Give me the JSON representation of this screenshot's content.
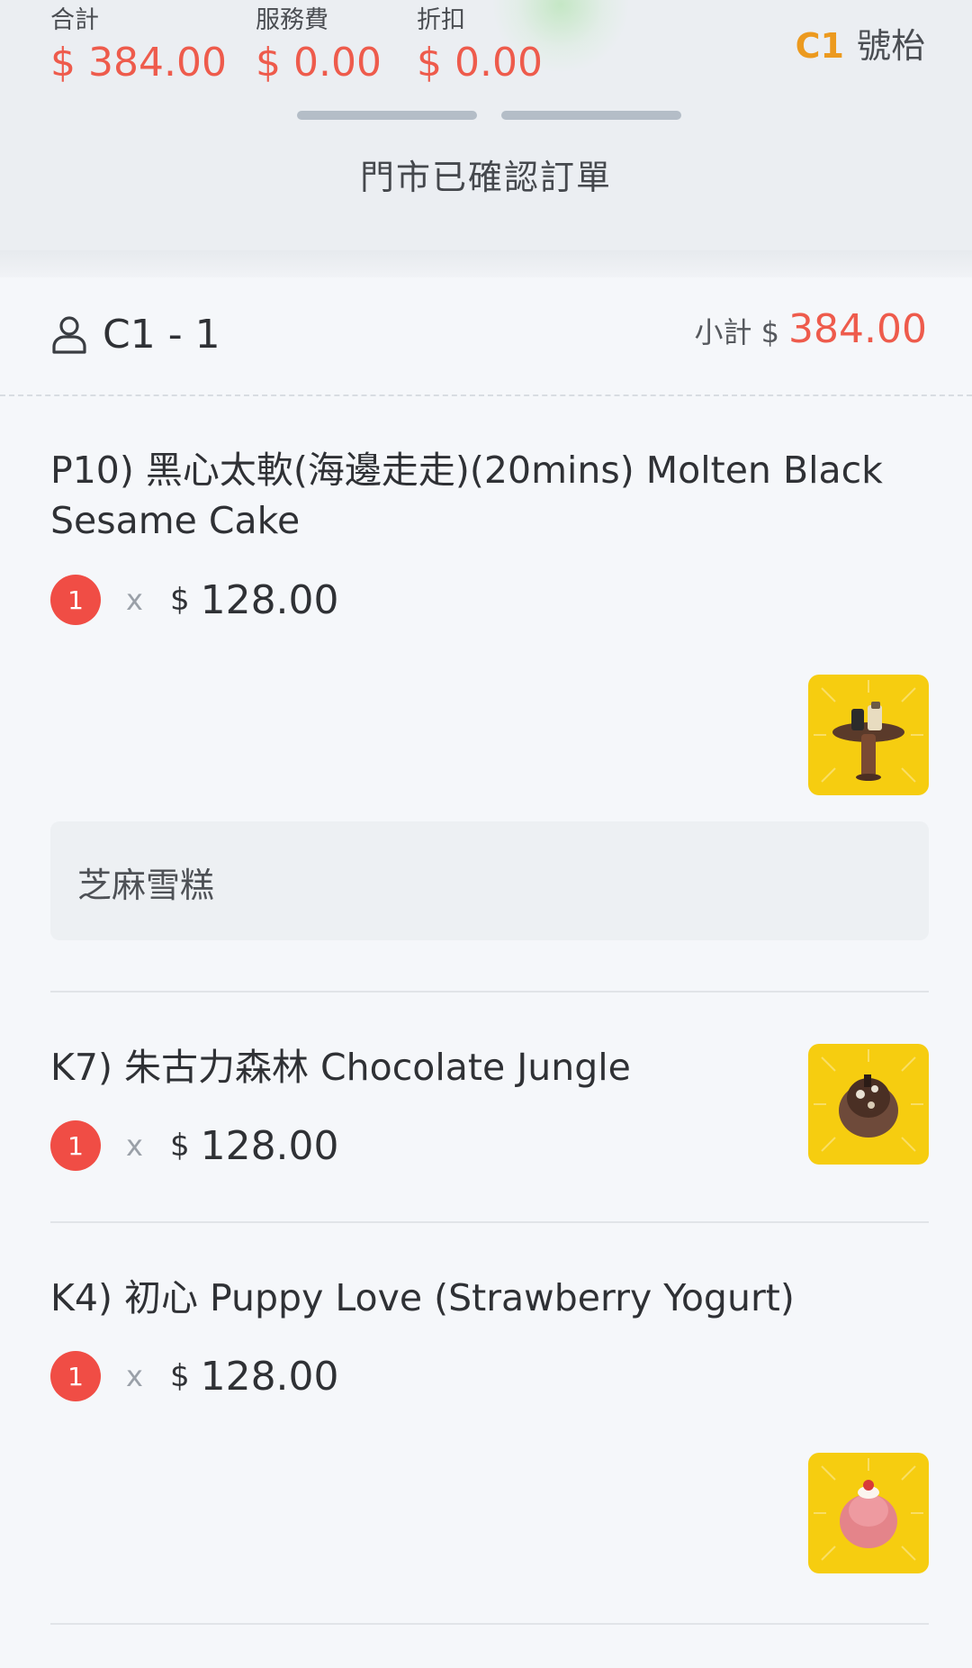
{
  "summary": {
    "total_label": "合計",
    "total_value": "$ 384.00",
    "service_label": "服務費",
    "service_value": "$ 0.00",
    "discount_label": "折扣",
    "discount_value": "$ 0.00"
  },
  "table": {
    "code": "C1",
    "suffix": "號枱"
  },
  "status": "門市已確認訂單",
  "seat": {
    "name": "C1 - 1",
    "subtotal_label": "小計 $",
    "subtotal_value": "384.00"
  },
  "items": [
    {
      "name": "P10) 黑心太軟(海邊走走)(20mins) Molten Black Sesame Cake",
      "qty": "1",
      "x": "x",
      "currency": "$",
      "price": "128.00",
      "note": "芝麻雪糕"
    },
    {
      "name": "K7) 朱古力森林 Chocolate Jungle",
      "qty": "1",
      "x": "x",
      "currency": "$",
      "price": "128.00"
    },
    {
      "name": "K4) 初心 Puppy Love (Strawberry Yogurt)",
      "qty": "1",
      "x": "x",
      "currency": "$",
      "price": "128.00"
    }
  ],
  "colors": {
    "accent_red": "#ee5b4c",
    "table_code_orange": "#ec9a1f",
    "thumb_yellow": "#f6cd10"
  }
}
